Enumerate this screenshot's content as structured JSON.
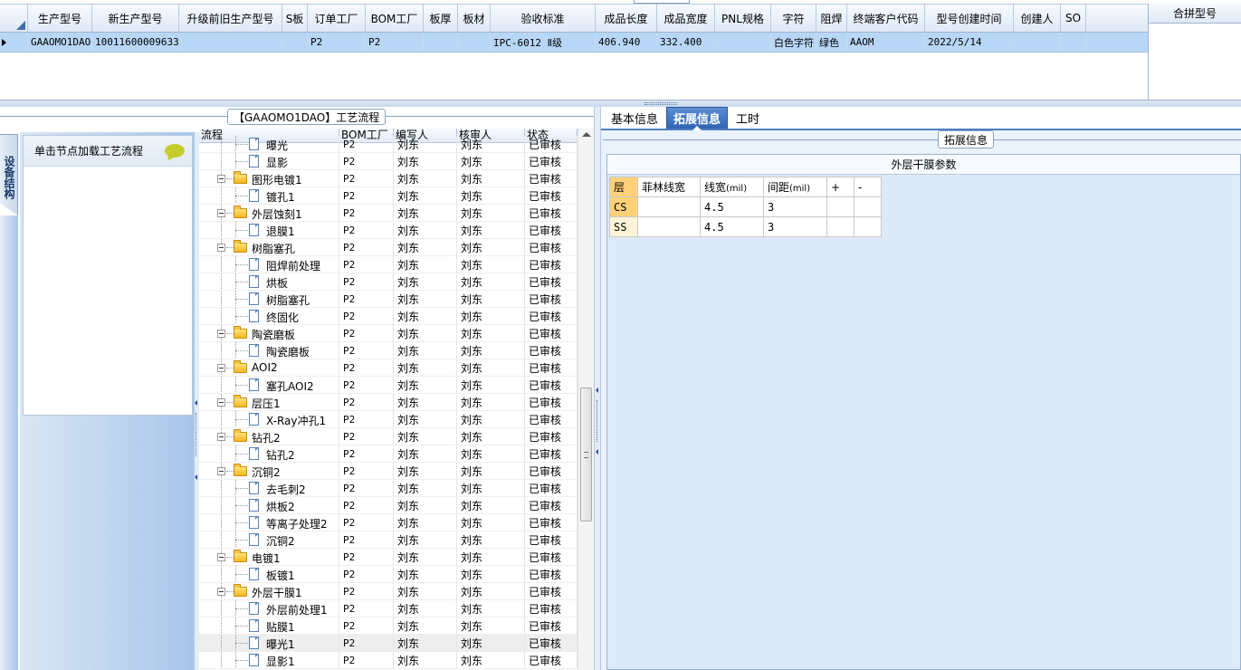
{
  "top_grid": {
    "columns": [
      "生产型号",
      "新生产型号",
      "升级前旧生产型号",
      "S板",
      "订单工厂",
      "BOM工厂",
      "板厚",
      "板材",
      "验收标准",
      "成品长度",
      "成品宽度",
      "PNL规格",
      "字符",
      "阻焊",
      "终端客户代码",
      "型号创建时间",
      "创建人",
      "SO"
    ],
    "row": [
      "GAAOMO1DAO",
      "10011600009633",
      "",
      "",
      "P2",
      "P2",
      "",
      "",
      "IPC-6012 Ⅱ级",
      "406.940",
      "332.400",
      "",
      "白色字符",
      "绿色",
      "AAOM",
      "2022/5/14",
      "",
      ""
    ]
  },
  "merge_panel": {
    "title": "合拼型号"
  },
  "left": {
    "groupbox_title": "【GAAOMO1DAO】工艺流程",
    "vertical_tab": "设备结构",
    "nav_hint": "单击节点加载工艺流程",
    "tree_columns": [
      "流程",
      "BOM工厂",
      "编写人",
      "核审人",
      "状态"
    ],
    "rows": [
      {
        "type": "leaf",
        "name": "曝光",
        "bom": "P2",
        "writer": "刘东",
        "reviewer": "刘东",
        "status": "已审核"
      },
      {
        "type": "leaf",
        "name": "显影",
        "bom": "P2",
        "writer": "刘东",
        "reviewer": "刘东",
        "status": "已审核"
      },
      {
        "type": "folder",
        "name": "图形电镀1",
        "bom": "P2",
        "writer": "刘东",
        "reviewer": "刘东",
        "status": "已审核"
      },
      {
        "type": "leaf",
        "name": "镀孔1",
        "bom": "P2",
        "writer": "刘东",
        "reviewer": "刘东",
        "status": "已审核"
      },
      {
        "type": "folder",
        "name": "外层蚀刻1",
        "bom": "P2",
        "writer": "刘东",
        "reviewer": "刘东",
        "status": "已审核"
      },
      {
        "type": "leaf",
        "name": "退膜1",
        "bom": "P2",
        "writer": "刘东",
        "reviewer": "刘东",
        "status": "已审核"
      },
      {
        "type": "folder",
        "name": "树脂塞孔",
        "bom": "P2",
        "writer": "刘东",
        "reviewer": "刘东",
        "status": "已审核"
      },
      {
        "type": "leaf",
        "name": "阻焊前处理",
        "bom": "P2",
        "writer": "刘东",
        "reviewer": "刘东",
        "status": "已审核"
      },
      {
        "type": "leaf",
        "name": "烘板",
        "bom": "P2",
        "writer": "刘东",
        "reviewer": "刘东",
        "status": "已审核"
      },
      {
        "type": "leaf",
        "name": "树脂塞孔",
        "bom": "P2",
        "writer": "刘东",
        "reviewer": "刘东",
        "status": "已审核"
      },
      {
        "type": "leaf",
        "name": "终固化",
        "bom": "P2",
        "writer": "刘东",
        "reviewer": "刘东",
        "status": "已审核"
      },
      {
        "type": "folder",
        "name": "陶瓷磨板",
        "bom": "P2",
        "writer": "刘东",
        "reviewer": "刘东",
        "status": "已审核"
      },
      {
        "type": "leaf",
        "name": "陶瓷磨板",
        "bom": "P2",
        "writer": "刘东",
        "reviewer": "刘东",
        "status": "已审核"
      },
      {
        "type": "folder",
        "name": "AOI2",
        "bom": "P2",
        "writer": "刘东",
        "reviewer": "刘东",
        "status": "已审核"
      },
      {
        "type": "leaf",
        "name": "塞孔AOI2",
        "bom": "P2",
        "writer": "刘东",
        "reviewer": "刘东",
        "status": "已审核"
      },
      {
        "type": "folder",
        "name": "层压1",
        "bom": "P2",
        "writer": "刘东",
        "reviewer": "刘东",
        "status": "已审核"
      },
      {
        "type": "leaf",
        "name": "X-Ray冲孔1",
        "bom": "P2",
        "writer": "刘东",
        "reviewer": "刘东",
        "status": "已审核"
      },
      {
        "type": "folder",
        "name": "钻孔2",
        "bom": "P2",
        "writer": "刘东",
        "reviewer": "刘东",
        "status": "已审核"
      },
      {
        "type": "leaf",
        "name": "钻孔2",
        "bom": "P2",
        "writer": "刘东",
        "reviewer": "刘东",
        "status": "已审核"
      },
      {
        "type": "folder",
        "name": "沉铜2",
        "bom": "P2",
        "writer": "刘东",
        "reviewer": "刘东",
        "status": "已审核"
      },
      {
        "type": "leaf",
        "name": "去毛刺2",
        "bom": "P2",
        "writer": "刘东",
        "reviewer": "刘东",
        "status": "已审核"
      },
      {
        "type": "leaf",
        "name": "烘板2",
        "bom": "P2",
        "writer": "刘东",
        "reviewer": "刘东",
        "status": "已审核"
      },
      {
        "type": "leaf",
        "name": "等离子处理2",
        "bom": "P2",
        "writer": "刘东",
        "reviewer": "刘东",
        "status": "已审核"
      },
      {
        "type": "leaf",
        "name": "沉铜2",
        "bom": "P2",
        "writer": "刘东",
        "reviewer": "刘东",
        "status": "已审核"
      },
      {
        "type": "folder",
        "name": "电镀1",
        "bom": "P2",
        "writer": "刘东",
        "reviewer": "刘东",
        "status": "已审核"
      },
      {
        "type": "leaf",
        "name": "板镀1",
        "bom": "P2",
        "writer": "刘东",
        "reviewer": "刘东",
        "status": "已审核"
      },
      {
        "type": "folder",
        "name": "外层干膜1",
        "bom": "P2",
        "writer": "刘东",
        "reviewer": "刘东",
        "status": "已审核"
      },
      {
        "type": "leaf",
        "name": "外层前处理1",
        "bom": "P2",
        "writer": "刘东",
        "reviewer": "刘东",
        "status": "已审核"
      },
      {
        "type": "leaf",
        "name": "贴膜1",
        "bom": "P2",
        "writer": "刘东",
        "reviewer": "刘东",
        "status": "已审核"
      },
      {
        "type": "leaf",
        "name": "曝光1",
        "bom": "P2",
        "writer": "刘东",
        "reviewer": "刘东",
        "status": "已审核",
        "selected": true
      },
      {
        "type": "leaf",
        "name": "显影1",
        "bom": "P2",
        "writer": "刘东",
        "reviewer": "刘东",
        "status": "已审核"
      }
    ]
  },
  "right": {
    "tabs": [
      "基本信息",
      "拓展信息",
      "工时"
    ],
    "active_tab": "拓展信息",
    "ext_title": "拓展信息",
    "outer_title": "外层干膜参数",
    "param_columns": [
      "层",
      "菲林线宽",
      "线宽(mil)",
      "间距(mil)",
      "+",
      "-"
    ],
    "param_rows": [
      {
        "layer": "CS",
        "film_width": "",
        "line_width": "4.5",
        "spacing": "3"
      },
      {
        "layer": "SS",
        "film_width": "",
        "line_width": "4.5",
        "spacing": "3"
      }
    ]
  },
  "colors": {
    "selected_row": "#b8d7f6",
    "active_tab": "#3a6fc0",
    "layer_header": "#ffd27a",
    "folder": "#f5b722"
  }
}
